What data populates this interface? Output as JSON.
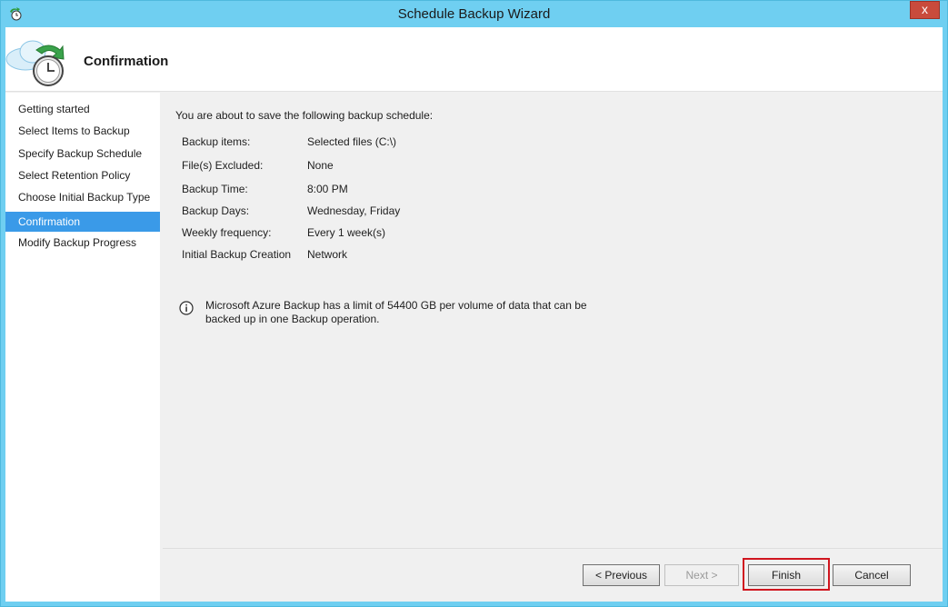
{
  "window": {
    "title": "Schedule Backup Wizard",
    "close_label": "x"
  },
  "header": {
    "title": "Confirmation"
  },
  "steps": [
    {
      "label": "Getting started",
      "active": false
    },
    {
      "label": "Select Items to Backup",
      "active": false
    },
    {
      "label": "Specify Backup Schedule",
      "active": false
    },
    {
      "label": "Select Retention Policy",
      "active": false
    },
    {
      "label": "Choose Initial Backup Type",
      "active": false
    },
    {
      "label": "Confirmation",
      "active": true
    },
    {
      "label": "Modify Backup Progress",
      "active": false
    }
  ],
  "summary": {
    "intro": "You are about to save the following backup schedule:",
    "rows": [
      {
        "key": "Backup items:",
        "value": "Selected files (C:\\)"
      },
      {
        "key": "File(s) Excluded:",
        "value": "None"
      },
      {
        "key": "Backup Time:",
        "value": "8:00 PM"
      },
      {
        "key": "Backup Days:",
        "value": "Wednesday, Friday"
      },
      {
        "key": "Weekly frequency:",
        "value": "Every 1 week(s)"
      },
      {
        "key": "Initial Backup Creation",
        "value": "Network"
      }
    ],
    "info": "Microsoft Azure Backup has a limit of 54400 GB per volume of data that can be backed up in one Backup operation."
  },
  "buttons": {
    "previous": "< Previous",
    "next": "Next >",
    "finish": "Finish",
    "cancel": "Cancel"
  },
  "colors": {
    "accent": "#3a9ae8",
    "frame": "#6fcff1",
    "highlight": "#d0161f"
  }
}
